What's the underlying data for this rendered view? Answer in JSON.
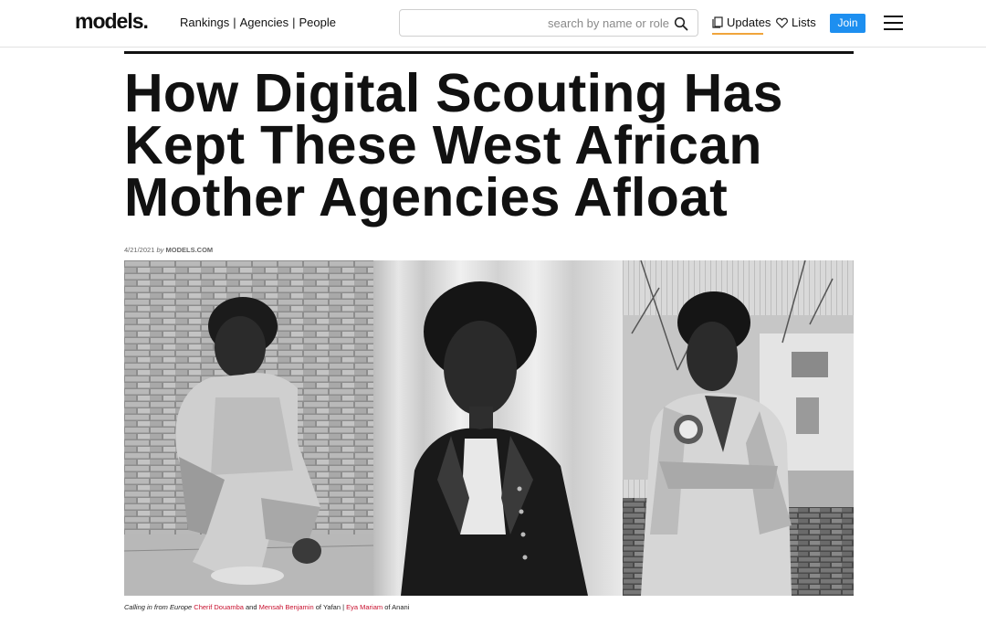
{
  "header": {
    "logo": "models.",
    "nav": [
      "Rankings",
      "Agencies",
      "People"
    ],
    "nav_separator": "|",
    "search_placeholder": "search by name or role",
    "updates_label": "Updates",
    "lists_label": "Lists",
    "join_label": "Join",
    "accent_color": "#f0a43b",
    "join_color": "#1d8ff0"
  },
  "article": {
    "headline": "How Digital Scouting Has Kept These West African Mother Agencies Afloat",
    "date": "4/21/2021",
    "by": "by",
    "author": "MODELS.COM",
    "photos": [
      "photo-model-brick-wall-crouching",
      "photo-model-denim-jacket-curtain",
      "photo-model-varsity-jacket-rooftop"
    ],
    "caption": {
      "intro": "Calling in from Europe",
      "name1": "Cherif Douamba",
      "and": "and",
      "name2": "Mensah Benjamin",
      "of1": "of Yafan |",
      "name3": "Eya Mariam",
      "of2": "of Anani",
      "link_color": "#c8102e"
    }
  }
}
